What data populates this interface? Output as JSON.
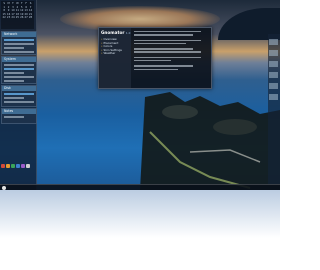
{
  "dialog": {
    "title": "Gnomator",
    "version": "1.0",
    "menu": [
      "Overview",
      "Placement",
      "Colors",
      "Skin Settings",
      "Weather"
    ]
  },
  "widgets": {
    "calendar": {
      "title": "",
      "days": [
        "S",
        "M",
        "T",
        "W",
        "T",
        "F",
        "S",
        "1",
        "2",
        "3",
        "4",
        "5",
        "6",
        "7",
        "8",
        "9",
        "10",
        "11",
        "12",
        "13",
        "14",
        "15",
        "16",
        "17",
        "18",
        "19",
        "20",
        "21",
        "22",
        "23",
        "24",
        "25",
        "26",
        "27",
        "28"
      ]
    },
    "w1": {
      "title": "Network"
    },
    "w2": {
      "title": "System"
    },
    "w3": {
      "title": "Disk"
    },
    "w4": {
      "title": "Notes"
    }
  },
  "colors": {
    "accent": "#3f6c93",
    "tray_red": "#d24b3a"
  }
}
